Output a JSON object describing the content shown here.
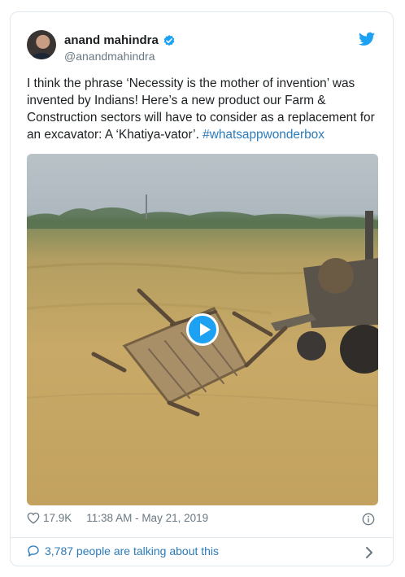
{
  "tweet": {
    "author_name": "anand mahindra",
    "handle": "@anandmahindra",
    "text_main": "I think the phrase ‘Necessity is the mother of invention’ was invented by Indians! Here’s a new product our Farm & Construction sectors will have to consider as a replacement for an excavator:  A ‘Khatiya-vator’.",
    "hashtag": "#whatsappwonderbox",
    "likes": "17.9K",
    "timestamp": "11:38 AM - May 21, 2019",
    "talking": "3,787 people are talking about this"
  },
  "icons": {
    "verified": "verified-badge-icon",
    "brand": "twitter-bird-icon",
    "like": "heart-icon",
    "info": "info-icon",
    "replies": "speech-bubble-icon",
    "more": "chevron-right-icon",
    "play": "play-icon"
  },
  "colors": {
    "accent": "#1da1f2",
    "link": "#2b7bb9",
    "muted": "#697882",
    "border": "#e1e8ed"
  }
}
